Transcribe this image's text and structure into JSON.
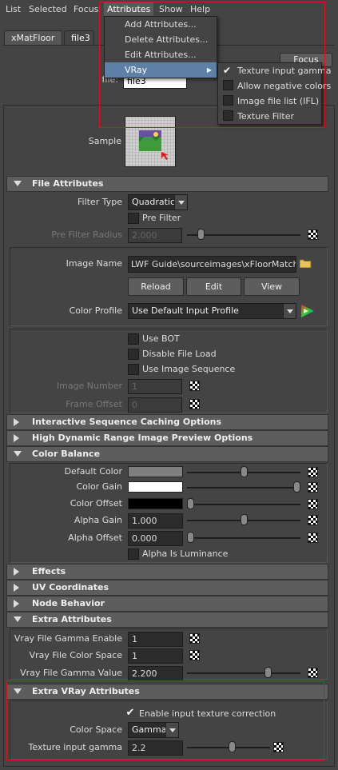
{
  "menubar": {
    "items": [
      "List",
      "Selected",
      "Focus",
      "Attributes",
      "Show",
      "Help"
    ]
  },
  "tabs": [
    "xMatFloor",
    "file3"
  ],
  "focus_label": "Focus",
  "node": {
    "label": "file:",
    "value": "file3"
  },
  "sample": {
    "label": "Sample"
  },
  "sections": {
    "file_attributes": "File Attributes",
    "interactive_caching": "Interactive Sequence Caching Options",
    "hdr_preview": "High Dynamic Range Image Preview Options",
    "color_balance": "Color Balance",
    "effects": "Effects",
    "uv_coordinates": "UV Coordinates",
    "node_behavior": "Node Behavior",
    "extra_attributes": "Extra Attributes",
    "extra_vray_attributes": "Extra VRay Attributes"
  },
  "file_attr": {
    "filter_type_label": "Filter Type",
    "filter_type": "Quadratic",
    "pre_filter": "Pre Filter",
    "pre_filter_radius_label": "Pre Filter Radius",
    "pre_filter_radius": "2.000",
    "image_name_label": "Image Name",
    "image_name": "LWF Guide\\sourceimages\\xFloorMatch.jpg",
    "reload": "Reload",
    "edit": "Edit",
    "view": "View",
    "color_profile_label": "Color Profile",
    "color_profile": "Use Default Input Profile",
    "use_bot": "Use BOT",
    "disable_file_load": "Disable File Load",
    "use_image_sequence": "Use Image Sequence",
    "image_number_label": "Image Number",
    "image_number": "1",
    "frame_offset_label": "Frame Offset",
    "frame_offset": "0"
  },
  "color_balance": {
    "default_color_label": "Default Color",
    "default_color": "#7f7f7f",
    "default_color_level": 0.5,
    "color_gain_label": "Color Gain",
    "color_gain": "#ffffff",
    "color_gain_level": 1.0,
    "color_offset_label": "Color Offset",
    "color_offset": "#000000",
    "color_offset_level": 0.0,
    "alpha_gain_label": "Alpha Gain",
    "alpha_gain": "1.000",
    "alpha_gain_level": 0.5,
    "alpha_offset_label": "Alpha Offset",
    "alpha_offset": "0.000",
    "alpha_offset_level": 0.0,
    "alpha_is_luminance": "Alpha Is Luminance"
  },
  "extra": {
    "gamma_enable_label": "Vray File Gamma Enable",
    "gamma_enable": "1",
    "color_space_label": "Vray File Color Space",
    "color_space": "1",
    "gamma_value_label": "Vray File Gamma Value",
    "gamma_value": "2.200",
    "gamma_value_level": 0.73
  },
  "extra_vray": {
    "enable_correction": "Enable input texture correction",
    "color_space_label": "Color Space",
    "color_space": "Gamma",
    "input_gamma_label": "Texture input gamma",
    "input_gamma": "2.2",
    "input_gamma_level": 0.55
  },
  "attributes_menu": {
    "items": [
      "Add Attributes...",
      "Delete Attributes...",
      "Edit Attributes...",
      "VRay"
    ]
  },
  "vray_submenu": {
    "items": [
      "Texture input gamma",
      "Allow negative colors",
      "Image file list (IFL)",
      "Texture Filter"
    ]
  },
  "colors": {
    "accent": "#5e7fa6",
    "highlight_box": "#d8151f"
  }
}
